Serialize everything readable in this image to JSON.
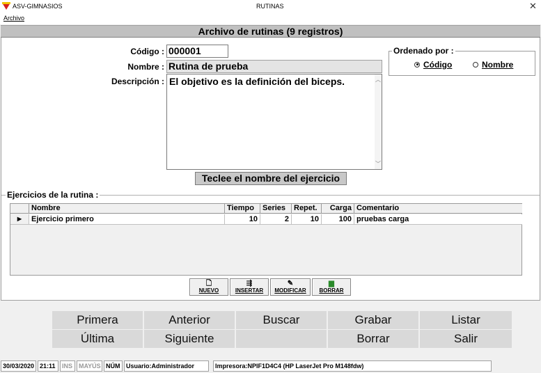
{
  "window": {
    "app_title": "ASV-GIMNASIOS",
    "title": "RUTINAS",
    "close": "✕"
  },
  "menu": {
    "archivo": "Archivo"
  },
  "header": {
    "title": "Archivo de rutinas (9 registros)"
  },
  "form": {
    "codigo_label": "Código :",
    "codigo_value": "000001",
    "nombre_label": "Nombre :",
    "nombre_value": "Rutina de prueba",
    "descripcion_label": "Descripción :",
    "descripcion_value": "El objetivo es la definición del biceps.",
    "hint": "Teclee el nombre del ejercicio"
  },
  "order": {
    "title": "Ordenado por :",
    "option_codigo": "Código",
    "option_nombre": "Nombre",
    "selected": "codigo"
  },
  "exercises": {
    "title": "Ejercicios de la rutina :",
    "columns": [
      "Nombre",
      "Tiempo",
      "Series",
      "Repet.",
      "Carga",
      "Comentario"
    ],
    "rows": [
      {
        "nombre": "Ejercicio primero",
        "tiempo": "10",
        "series": "2",
        "repet": "10",
        "carga": "100",
        "comentario": "pruebas carga"
      }
    ],
    "buttons": {
      "nuevo": "NUEVO",
      "insertar": "INSERTAR",
      "modificar": "MODIFICAR",
      "borrar": "BORRAR"
    }
  },
  "nav": {
    "primera": "Primera",
    "anterior": "Anterior",
    "buscar": "Buscar",
    "grabar": "Grabar",
    "listar": "Listar",
    "ultima": "Última",
    "siguiente": "Siguiente",
    "borrar": "Borrar",
    "salir": "Salir"
  },
  "status": {
    "date": "30/03/2020",
    "time": "21:11",
    "ins": "INS",
    "mayus": "MAYÚS",
    "num": "NÚM",
    "user": "Usuario:Administrador",
    "printer": "Impresora:NPIF1D4C4 (HP LaserJet Pro M148fdw)"
  }
}
